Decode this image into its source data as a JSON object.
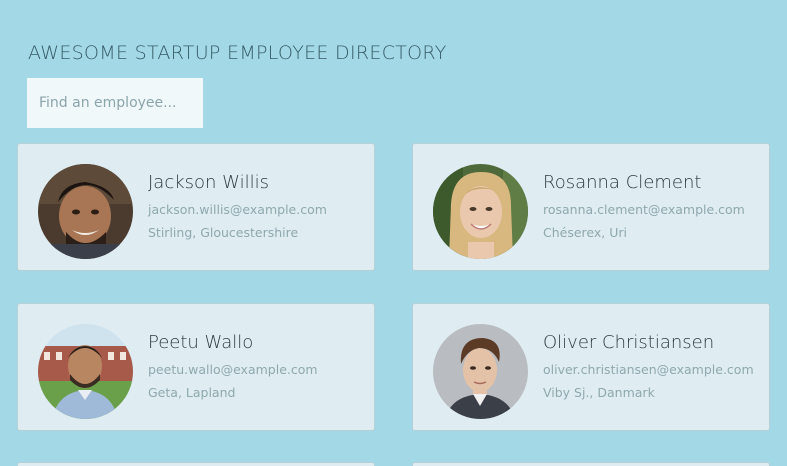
{
  "header": {
    "title": "Awesome Startup Employee Directory"
  },
  "search": {
    "placeholder": "Find an employee..."
  },
  "employees": [
    {
      "name": "Jackson Willis",
      "email": "jackson.willis@example.com",
      "location": "Stirling, Gloucestershire",
      "avatar": "man-dark-hair-photo"
    },
    {
      "name": "Rosanna Clement",
      "email": "rosanna.clement@example.com",
      "location": "Chéserex, Uri",
      "avatar": "woman-blonde-photo"
    },
    {
      "name": "Peetu Wallo",
      "email": "peetu.wallo@example.com",
      "location": "Geta, Lapland",
      "avatar": "man-outdoor-photo"
    },
    {
      "name": "Oliver Christiansen",
      "email": "oliver.christiansen@example.com",
      "location": "Viby Sj., Danmark",
      "avatar": "man-grey-background-photo"
    }
  ],
  "colors": {
    "background": "#a3d9e6",
    "card": "#dfedf2",
    "title": "#355b66",
    "name": "#2d3b40",
    "secondary_text": "#8ea8ae"
  }
}
